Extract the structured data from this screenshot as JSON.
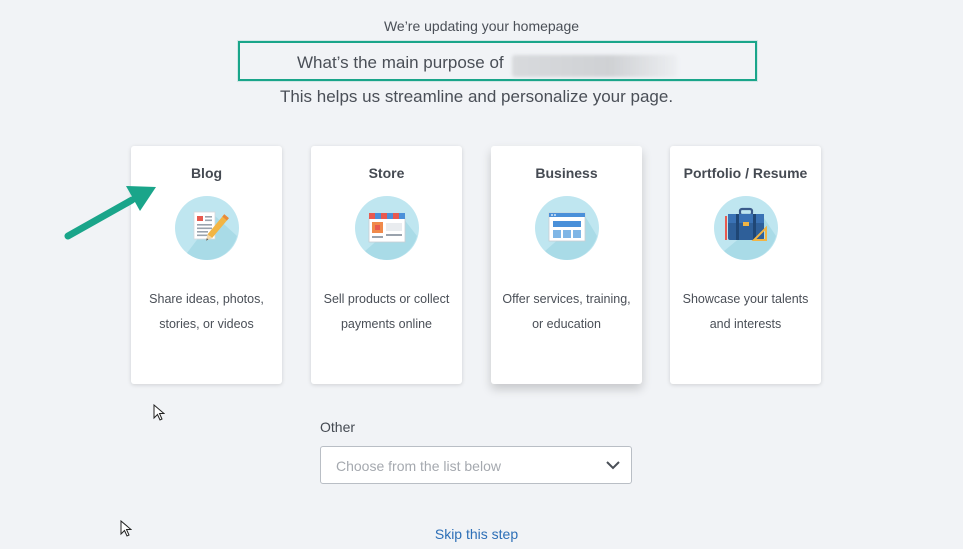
{
  "header": {
    "subtitle": "We’re updating your homepage",
    "question": "What’s the main purpose of",
    "helper": "This helps us streamline and personalize your page."
  },
  "cards": [
    {
      "title": "Blog",
      "description": "Share ideas, photos, stories, or videos",
      "icon": "blog-icon"
    },
    {
      "title": "Store",
      "description": "Sell products or collect payments online",
      "icon": "store-icon"
    },
    {
      "title": "Business",
      "description": "Offer services, training, or education",
      "icon": "business-icon"
    },
    {
      "title": "Portfolio / Resume",
      "description": "Showcase your talents and interests",
      "icon": "portfolio-icon"
    }
  ],
  "other": {
    "label": "Other",
    "placeholder": "Choose from the list below"
  },
  "skip": {
    "label": "Skip this step"
  },
  "colors": {
    "background": "#f1f3f6",
    "highlight": "#1aa58a",
    "link": "#2d6fb7",
    "icon_circle": "#bfe6f0"
  }
}
